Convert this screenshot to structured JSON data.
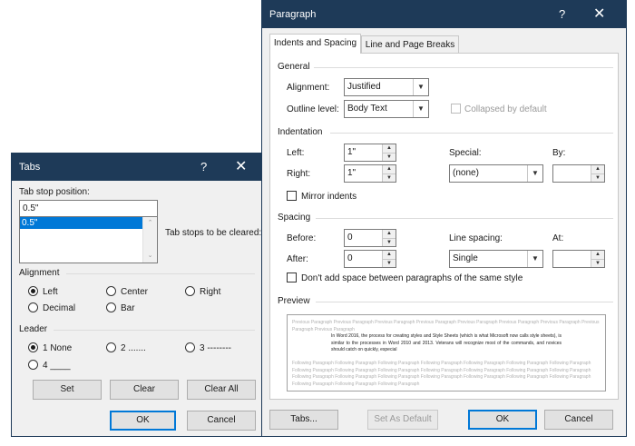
{
  "tabs_dialog": {
    "title": "Tabs",
    "help_glyph": "?",
    "close_glyph": "✕",
    "tab_stop_label": "Tab stop position:",
    "tab_stop_value": "0.5\"",
    "list_items": [
      "0.5\""
    ],
    "to_be_cleared_label": "Tab stops to be cleared:",
    "alignment_label": "Alignment",
    "alignment_options": [
      "Left",
      "Center",
      "Right",
      "Decimal",
      "Bar"
    ],
    "alignment_selected": "Left",
    "leader_label": "Leader",
    "leader_options": [
      "1 None",
      "2 .......",
      "3 --------",
      "4 ____"
    ],
    "leader_selected": "1 None",
    "set_button": "Set",
    "clear_button": "Clear",
    "clear_all_button": "Clear All",
    "ok_button": "OK",
    "cancel_button": "Cancel"
  },
  "paragraph_dialog": {
    "title": "Paragraph",
    "help_glyph": "?",
    "close_glyph": "✕",
    "tabs": [
      "Indents and Spacing",
      "Line and Page Breaks"
    ],
    "active_tab": "Indents and Spacing",
    "general": {
      "heading": "General",
      "alignment_label": "Alignment:",
      "alignment_value": "Justified",
      "outline_label": "Outline level:",
      "outline_value": "Body Text",
      "collapsed_label": "Collapsed by default"
    },
    "indentation": {
      "heading": "Indentation",
      "left_label": "Left:",
      "left_value": "1\"",
      "right_label": "Right:",
      "right_value": "1\"",
      "special_label": "Special:",
      "special_value": "(none)",
      "by_label": "By:",
      "by_value": "",
      "mirror_label": "Mirror indents"
    },
    "spacing": {
      "heading": "Spacing",
      "before_label": "Before:",
      "before_value": "0",
      "after_label": "After:",
      "after_value": "0",
      "line_spacing_label": "Line spacing:",
      "line_spacing_value": "Single",
      "at_label": "At:",
      "at_value": "",
      "dont_add_label": "Don't add space between paragraphs of the same style"
    },
    "preview": {
      "heading": "Preview",
      "previous_text": "Previous Paragraph Previous Paragraph Previous Paragraph Previous Paragraph Previous Paragraph Previous Paragraph Previous Paragraph Previous Paragraph Previous Paragraph",
      "sample_text": "In Word 2016, the process for creating styles and Style Sheets (which is what Microsoft now calls style sheets), is similar to the processes in Word 2010 and 2013. Veterans will recognize most of the commands, and novices should catch on quickly, especial",
      "following_text": "Following Paragraph Following Paragraph Following Paragraph Following Paragraph Following Paragraph Following Paragraph Following Paragraph Following Paragraph Following Paragraph Following Paragraph Following Paragraph Following Paragraph Following Paragraph Following Paragraph Following Paragraph Following Paragraph Following Paragraph Following Paragraph Following Paragraph Following Paragraph Following Paragraph Following Paragraph Following Paragraph Following Paragraph"
    },
    "tabs_button": "Tabs...",
    "set_default_button": "Set As Default",
    "ok_button": "OK",
    "cancel_button": "Cancel"
  }
}
